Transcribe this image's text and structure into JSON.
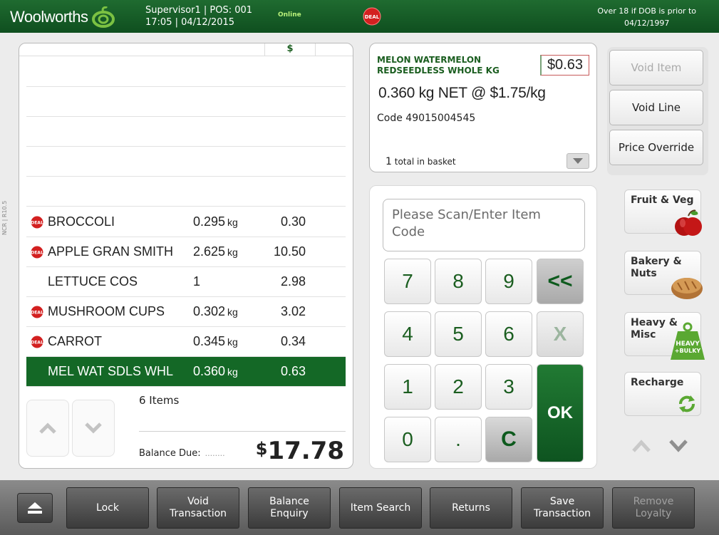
{
  "header": {
    "logo_text": "Woolworths",
    "user": "Supervisor1",
    "pos": "POS: 001",
    "time": "17:05",
    "date": "04/12/2015",
    "status": "Online",
    "deal_badge": "DEAL",
    "age_line1": "Over 18 if DOB is prior to",
    "age_line2": "04/12/1997"
  },
  "receipt": {
    "price_column_header": "$",
    "rows": [
      {
        "deal": true,
        "name": "BROCCOLI",
        "qty": "0.295",
        "unit": "kg",
        "price": "0.30"
      },
      {
        "deal": true,
        "name": "APPLE GRAN SMITH",
        "qty": "2.625",
        "unit": "kg",
        "price": "10.50"
      },
      {
        "deal": false,
        "name": "LETTUCE COS",
        "qty": "1",
        "unit": "",
        "price": "2.98"
      },
      {
        "deal": true,
        "name": "MUSHROOM CUPS",
        "qty": "0.302",
        "unit": "kg",
        "price": "3.02"
      },
      {
        "deal": true,
        "name": "CARROT",
        "qty": "0.345",
        "unit": "kg",
        "price": "0.34"
      },
      {
        "deal": false,
        "name": "MEL WAT SDLS WHL",
        "qty": "0.360",
        "unit": "kg",
        "price": "0.63",
        "selected": true
      }
    ],
    "items_count": "6 Items",
    "balance_label": "Balance Due:",
    "balance_dots": "........",
    "balance_currency": "$",
    "balance_amount": "17.78"
  },
  "item_detail": {
    "name_line1": "MELON WATERMELON",
    "name_line2": "REDSEEDLESS WHOLE KG",
    "price": "$0.63",
    "weight": "0.360 kg NET @ $1.75/kg",
    "code": "Code 49015004545",
    "basket_count": "1",
    "basket_label": "total in basket"
  },
  "actions": {
    "void_item": "Void Item",
    "void_line": "Void Line",
    "price_override": "Price Override"
  },
  "entry": {
    "placeholder": "Please Scan/Enter Item Code"
  },
  "keypad": {
    "k7": "7",
    "k8": "8",
    "k9": "9",
    "backspace": "<<",
    "k4": "4",
    "k5": "5",
    "k6": "6",
    "clear_x": "X",
    "k1": "1",
    "k2": "2",
    "k3": "3",
    "ok": "OK",
    "k0": "0",
    "dot": ".",
    "clear_c": "C"
  },
  "categories": {
    "fruit_veg": "Fruit & Veg",
    "bakery_line1": "Bakery &",
    "bakery_line2": "Nuts",
    "heavy_line1": "Heavy &",
    "heavy_line2": "Misc",
    "heavy_tag_line1": "HEAVY",
    "heavy_tag_line2": "+BULKY",
    "recharge": "Recharge"
  },
  "bottom_bar": {
    "lock": "Lock",
    "void_transaction_1": "Void",
    "void_transaction_2": "Transaction",
    "balance_enquiry_1": "Balance",
    "balance_enquiry_2": "Enquiry",
    "item_search": "Item Search",
    "returns": "Returns",
    "save_transaction_1": "Save",
    "save_transaction_2": "Transaction",
    "remove_loyalty_1": "Remove",
    "remove_loyalty_2": "Loyalty"
  },
  "side_label": "NCR | R10.5",
  "colors": {
    "brand_green": "#146826",
    "deal_red": "#d32020",
    "panel_bg": "#ffffff"
  }
}
